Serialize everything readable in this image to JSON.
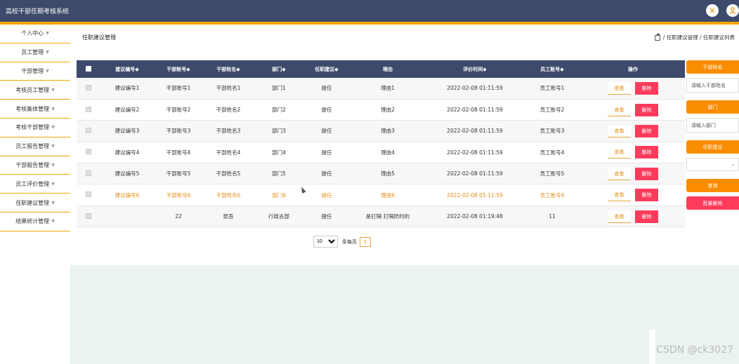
{
  "app": {
    "title": "高校干部任期考核系统"
  },
  "header": {
    "close_icon": "close-icon",
    "user_icon": "user-icon"
  },
  "sidebar": {
    "items": [
      {
        "label": "个人中心"
      },
      {
        "label": "员工管理"
      },
      {
        "label": "干部管理"
      },
      {
        "label": "考核员工管理"
      },
      {
        "label": "考核集体管理"
      },
      {
        "label": "考核干部管理"
      },
      {
        "label": "员工报告管理"
      },
      {
        "label": "干部报告管理"
      },
      {
        "label": "员工评价管理"
      },
      {
        "label": "任职建议管理"
      },
      {
        "label": "结果统计管理"
      }
    ]
  },
  "page": {
    "title": "任职建议管理",
    "breadcrumb": "/ 任职建议管理 / 任职建议列表"
  },
  "table": {
    "columns": [
      "建议编号◆",
      "干部账号◆",
      "干部姓名◆",
      "部门◆",
      "任职建议◆",
      "理由",
      "评价时间◆",
      "员工账号◆",
      "操作"
    ],
    "view_label": "查看",
    "delete_label": "删除",
    "rows": [
      [
        "建议编号1",
        "干部账号1",
        "干部姓名1",
        "部门1",
        "提任",
        "理由1",
        "2022-02-08 01:11:59",
        "员工账号1"
      ],
      [
        "建议编号2",
        "干部账号2",
        "干部姓名2",
        "部门2",
        "提任",
        "理由2",
        "2022-02-08 01:11:59",
        "员工账号2"
      ],
      [
        "建议编号3",
        "干部账号3",
        "干部姓名3",
        "部门3",
        "提任",
        "理由3",
        "2022-02-08 01:11:59",
        "员工账号3"
      ],
      [
        "建议编号4",
        "干部账号4",
        "干部姓名4",
        "部门4",
        "提任",
        "理由4",
        "2022-02-08 01:11:59",
        "员工账号4"
      ],
      [
        "建议编号5",
        "干部账号5",
        "干部姓名5",
        "部门5",
        "提任",
        "理由5",
        "2022-02-08 01:11:59",
        "员工账号5"
      ],
      [
        "建议编号6",
        "干部账号6",
        "干部姓名6",
        "部门6",
        "提任",
        "理由6",
        "2022-02-08 01:11:59",
        "员工账号6"
      ],
      [
        "",
        "22",
        "昆吾",
        "行政去部",
        "提任",
        "是打隔 打隔防时的",
        "2022-02-08 01:19:48",
        "11"
      ]
    ],
    "highlighted_row": 5
  },
  "pager": {
    "page_size": "10",
    "page_size_label": "条每页",
    "current_page": "1"
  },
  "filters": {
    "cadre_name_label": "干部姓名",
    "cadre_name_placeholder": "请输入干部姓名",
    "department_label": "部门",
    "department_placeholder": "请输入部门",
    "suggestion_label": "任职建议",
    "search_label": "查询",
    "bulk_delete_label": "批量删除"
  },
  "watermark": "CSDN @ck3027"
}
